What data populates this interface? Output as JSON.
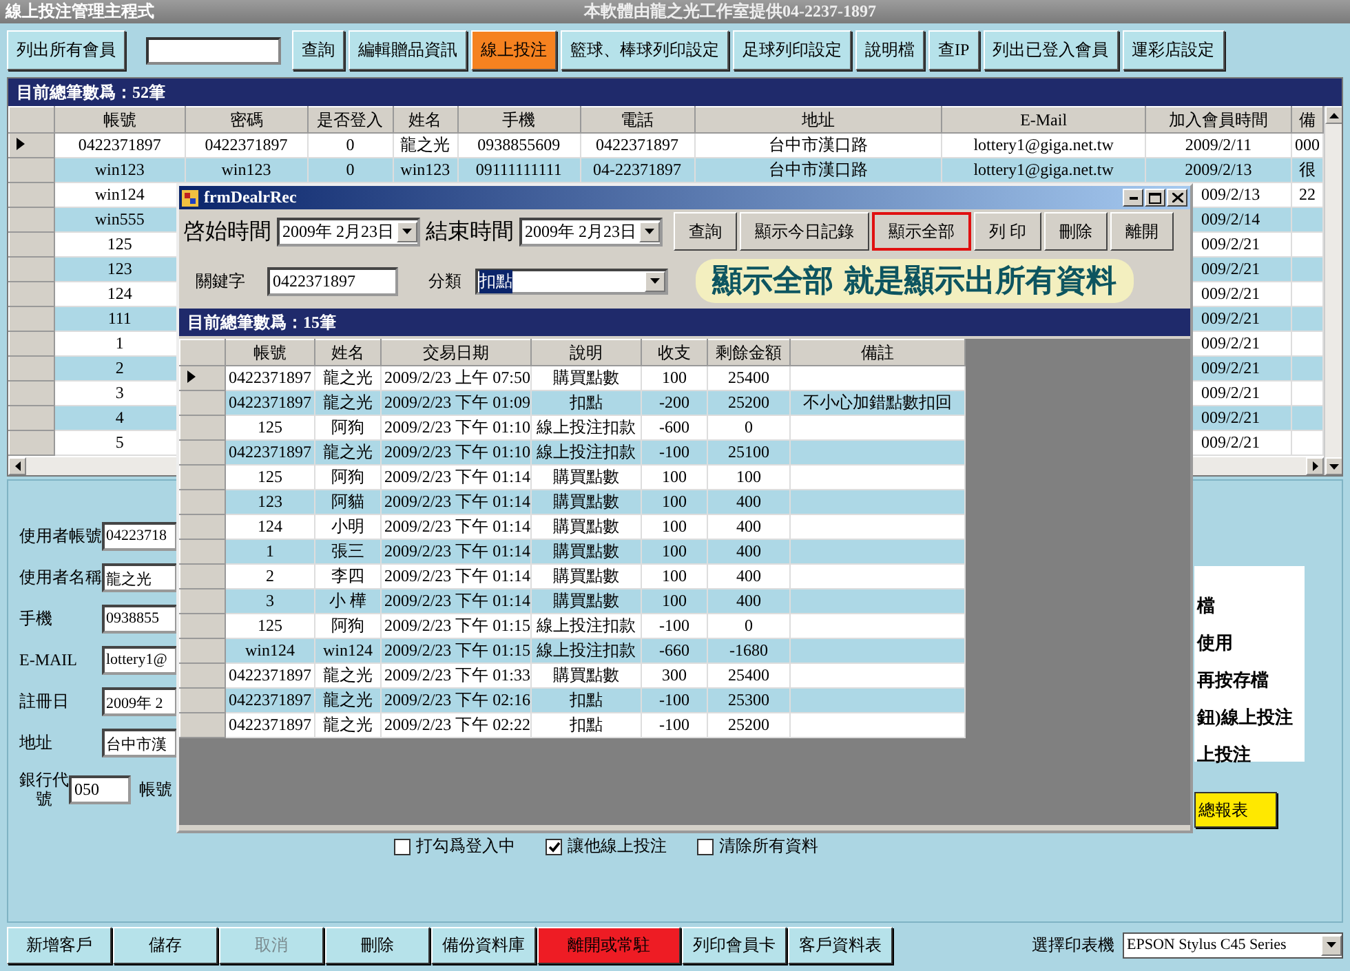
{
  "window": {
    "title": "線上投注管理主程式",
    "banner": "本軟體由龍之光工作室提供04-2237-1897"
  },
  "toolbar": [
    {
      "kind": "button",
      "label": "列出所有會員",
      "selected": false
    },
    {
      "kind": "search"
    },
    {
      "kind": "button",
      "label": "查詢",
      "selected": false
    },
    {
      "kind": "button",
      "label": "編輯贈品資訊",
      "selected": false
    },
    {
      "kind": "button",
      "label": "線上投注",
      "selected": true
    },
    {
      "kind": "button",
      "label": "籃球、棒球列印設定",
      "selected": false
    },
    {
      "kind": "button",
      "label": "足球列印設定",
      "selected": false
    },
    {
      "kind": "button",
      "label": "說明檔",
      "selected": false
    },
    {
      "kind": "button",
      "label": "查IP",
      "selected": false
    },
    {
      "kind": "button",
      "label": "列出已登入會員",
      "selected": false
    },
    {
      "kind": "button",
      "label": "運彩店設定",
      "selected": false
    }
  ],
  "members": {
    "count_label": "目前總筆數爲：52筆",
    "columns": [
      "帳號",
      "密碼",
      "是否登入",
      "姓名",
      "手機",
      "電話",
      "地址",
      "E-Mail",
      "加入會員時間",
      "備"
    ],
    "rows": [
      {
        "selected": true,
        "cells": [
          "0422371897",
          "0422371897",
          "0",
          "龍之光",
          "0938855609",
          "0422371897",
          "台中市漢口路",
          "lottery1@giga.net.tw",
          "2009/2/11",
          "000"
        ]
      },
      {
        "selected": false,
        "cells": [
          "win123",
          "win123",
          "0",
          "win123",
          "09111111111",
          "04-22371897",
          "台中市漢口路",
          "lottery1@giga.net.tw",
          "2009/2/13",
          "很"
        ]
      },
      {
        "selected": false,
        "cells": [
          "win124"
        ],
        "right_cells": [
          "009/2/13",
          "22"
        ]
      },
      {
        "selected": false,
        "cells": [
          "win555"
        ],
        "right_cells": [
          "009/2/14"
        ]
      },
      {
        "selected": false,
        "cells": [
          "125"
        ],
        "right_cells": [
          "009/2/21"
        ]
      },
      {
        "selected": false,
        "cells": [
          "123"
        ],
        "right_cells": [
          "009/2/21"
        ]
      },
      {
        "selected": false,
        "cells": [
          "124"
        ],
        "right_cells": [
          "009/2/21"
        ]
      },
      {
        "selected": false,
        "cells": [
          "111"
        ],
        "right_cells": [
          "009/2/21"
        ]
      },
      {
        "selected": false,
        "cells": [
          "1"
        ],
        "right_cells": [
          "009/2/21"
        ]
      },
      {
        "selected": false,
        "cells": [
          "2"
        ],
        "right_cells": [
          "009/2/21"
        ]
      },
      {
        "selected": false,
        "cells": [
          "3"
        ],
        "right_cells": [
          "009/2/21"
        ]
      },
      {
        "selected": false,
        "cells": [
          "4"
        ],
        "right_cells": [
          "009/2/21"
        ]
      },
      {
        "selected": false,
        "cells": [
          "5"
        ],
        "right_cells": [
          "009/2/21"
        ]
      }
    ]
  },
  "form": [
    {
      "label": "使用者帳號",
      "value": "04223718"
    },
    {
      "label": "使用者名稱",
      "value": "龍之光"
    },
    {
      "label": "手機",
      "value": "0938855"
    },
    {
      "label": "E-MAIL",
      "value": "lottery1@"
    },
    {
      "label": "註冊日",
      "value": "2009年  2"
    },
    {
      "label": "地址",
      "value": "台中市漢"
    }
  ],
  "bank": {
    "label": "銀行代號",
    "value": "050",
    "account_label": "帳號"
  },
  "notes": [
    "檔",
    "使用",
    "再按存檔",
    "鈕)線上投注",
    "上投注"
  ],
  "report_button": "總報表",
  "checkboxes": [
    {
      "label": "打勾爲登入中",
      "checked": false
    },
    {
      "label": "讓他線上投注",
      "checked": true
    },
    {
      "label": "清除所有資料",
      "checked": false
    }
  ],
  "bottom_buttons": [
    {
      "label": "新增客戶",
      "kind": "normal"
    },
    {
      "label": "儲存",
      "kind": "normal"
    },
    {
      "label": "取消",
      "kind": "disabled"
    },
    {
      "label": "刪除",
      "kind": "normal"
    },
    {
      "label": "備份資料庫",
      "kind": "normal"
    },
    {
      "label": "離開或常駐",
      "kind": "danger"
    },
    {
      "label": "列印會員卡",
      "kind": "normal"
    },
    {
      "label": "客戶資料表",
      "kind": "normal"
    }
  ],
  "printer": {
    "label": "選擇印表機",
    "value": "EPSON Stylus C45 Series"
  },
  "dialog": {
    "title": "frmDealrRec",
    "start_label": "啓始時間",
    "start_date": "2009年  2月23日",
    "end_label": "結束時間",
    "end_date": "2009年  2月23日",
    "buttons": [
      {
        "label": "查詢",
        "highlighted": false
      },
      {
        "label": "顯示今日記錄",
        "highlighted": false
      },
      {
        "label": "顯示全部",
        "highlighted": true
      },
      {
        "label": "列 印",
        "highlighted": false
      },
      {
        "label": "刪除",
        "highlighted": false
      },
      {
        "label": "離開",
        "highlighted": false
      }
    ],
    "keyword_label": "關鍵字",
    "keyword": "0422371897",
    "category_label": "分類",
    "category": "扣點",
    "callout": "顯示全部  就是顯示出所有資料",
    "count_label": "目前總筆數爲：15筆",
    "columns": [
      "帳號",
      "姓名",
      "交易日期",
      "說明",
      "收支",
      "剩餘金額",
      "備註"
    ],
    "rows": [
      {
        "selected": true,
        "cells": [
          "0422371897",
          "龍之光",
          "2009/2/23 上午 07:50",
          "購買點數",
          "100",
          "25400"
        ]
      },
      {
        "selected": false,
        "cells": [
          "0422371897",
          "龍之光",
          "2009/2/23 下午 01:09",
          "扣點",
          "-200",
          "25200",
          "不小心加錯點數扣回"
        ]
      },
      {
        "selected": false,
        "cells": [
          "125",
          "阿狗",
          "2009/2/23 下午 01:10",
          "線上投注扣款",
          "-600",
          "0"
        ]
      },
      {
        "selected": false,
        "cells": [
          "0422371897",
          "龍之光",
          "2009/2/23 下午 01:10",
          "線上投注扣款",
          "-100",
          "25100"
        ]
      },
      {
        "selected": false,
        "cells": [
          "125",
          "阿狗",
          "2009/2/23 下午 01:14",
          "購買點數",
          "100",
          "100"
        ]
      },
      {
        "selected": false,
        "cells": [
          "123",
          "阿貓",
          "2009/2/23 下午 01:14",
          "購買點數",
          "100",
          "400"
        ]
      },
      {
        "selected": false,
        "cells": [
          "124",
          "小明",
          "2009/2/23 下午 01:14",
          "購買點數",
          "100",
          "400"
        ]
      },
      {
        "selected": false,
        "cells": [
          "1",
          "張三",
          "2009/2/23 下午 01:14",
          "購買點數",
          "100",
          "400"
        ]
      },
      {
        "selected": false,
        "cells": [
          "2",
          "李四",
          "2009/2/23 下午 01:14",
          "購買點數",
          "100",
          "400"
        ]
      },
      {
        "selected": false,
        "cells": [
          "3",
          "小 樺",
          "2009/2/23 下午 01:14",
          "購買點數",
          "100",
          "400"
        ]
      },
      {
        "selected": false,
        "cells": [
          "125",
          "阿狗",
          "2009/2/23 下午 01:15",
          "線上投注扣款",
          "-100",
          "0"
        ]
      },
      {
        "selected": false,
        "cells": [
          "win124",
          "win124",
          "2009/2/23 下午 01:15",
          "線上投注扣款",
          "-660",
          "-1680"
        ]
      },
      {
        "selected": false,
        "cells": [
          "0422371897",
          "龍之光",
          "2009/2/23 下午 01:33",
          "購買點數",
          "300",
          "25400"
        ]
      },
      {
        "selected": false,
        "cells": [
          "0422371897",
          "龍之光",
          "2009/2/23 下午 02:16",
          "扣點",
          "-100",
          "25300"
        ]
      },
      {
        "selected": false,
        "cells": [
          "0422371897",
          "龍之光",
          "2009/2/23 下午 02:22",
          "扣點",
          "-100",
          "25200"
        ]
      }
    ]
  }
}
